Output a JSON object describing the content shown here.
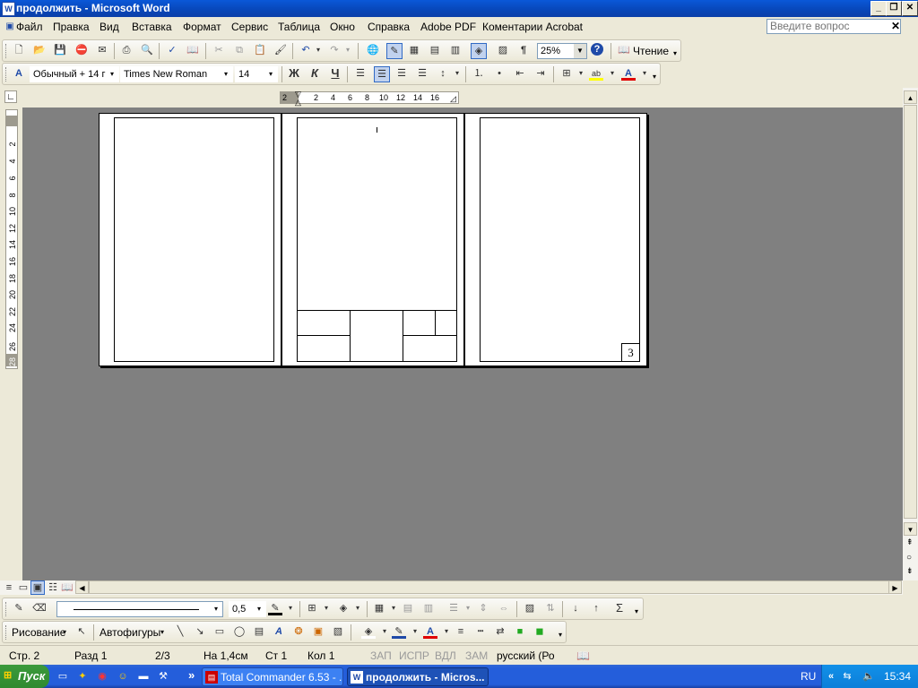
{
  "window": {
    "title": "продолжить - Microsoft Word",
    "app_icon": "W"
  },
  "menu": {
    "items": [
      "Файл",
      "Правка",
      "Вид",
      "Вставка",
      "Формат",
      "Сервис",
      "Таблица",
      "Окно",
      "Справка",
      "Adobe PDF",
      "Коментарии Acrobat"
    ],
    "ask_placeholder": "Введите вопрос"
  },
  "standard_toolbar": {
    "zoom": "25%",
    "read_label": "Чтение",
    "pilcrow": "¶",
    "help": "?"
  },
  "format_toolbar": {
    "style": "Обычный + 14 г",
    "font": "Times New Roman",
    "size": "14",
    "bold": "Ж",
    "italic": "К",
    "underline": "Ч",
    "font_color_glyph": "A",
    "highlight_glyph": "ab"
  },
  "ruler": {
    "h_numbers": [
      "2",
      "2",
      "4",
      "6",
      "8",
      "10",
      "12",
      "14",
      "16"
    ],
    "v_numbers": [
      "2",
      "4",
      "6",
      "8",
      "10",
      "12",
      "14",
      "16",
      "18",
      "20",
      "22",
      "24",
      "26",
      "28"
    ]
  },
  "document": {
    "page_number": "3"
  },
  "drawing_toolbar": {
    "drawing_label": "Рисование",
    "autoshapes_label": "Автофигуры",
    "line_width": "0,5",
    "sigma": "Σ"
  },
  "status": {
    "page": "Стр. 2",
    "section": "Разд 1",
    "pages": "2/3",
    "at": "На 1,4см",
    "line": "Ст 1",
    "col": "Кол 1",
    "rec": "ЗАП",
    "trk": "ИСПР",
    "ext": "ВДЛ",
    "ovr": "ЗАМ",
    "lang": "русский (Ро"
  },
  "taskbar": {
    "start": "Пуск",
    "tasks": [
      "Total Commander 6.53 - ...",
      "продолжить - Micros..."
    ],
    "lang": "RU",
    "time": "15:34",
    "chevron": "»"
  }
}
